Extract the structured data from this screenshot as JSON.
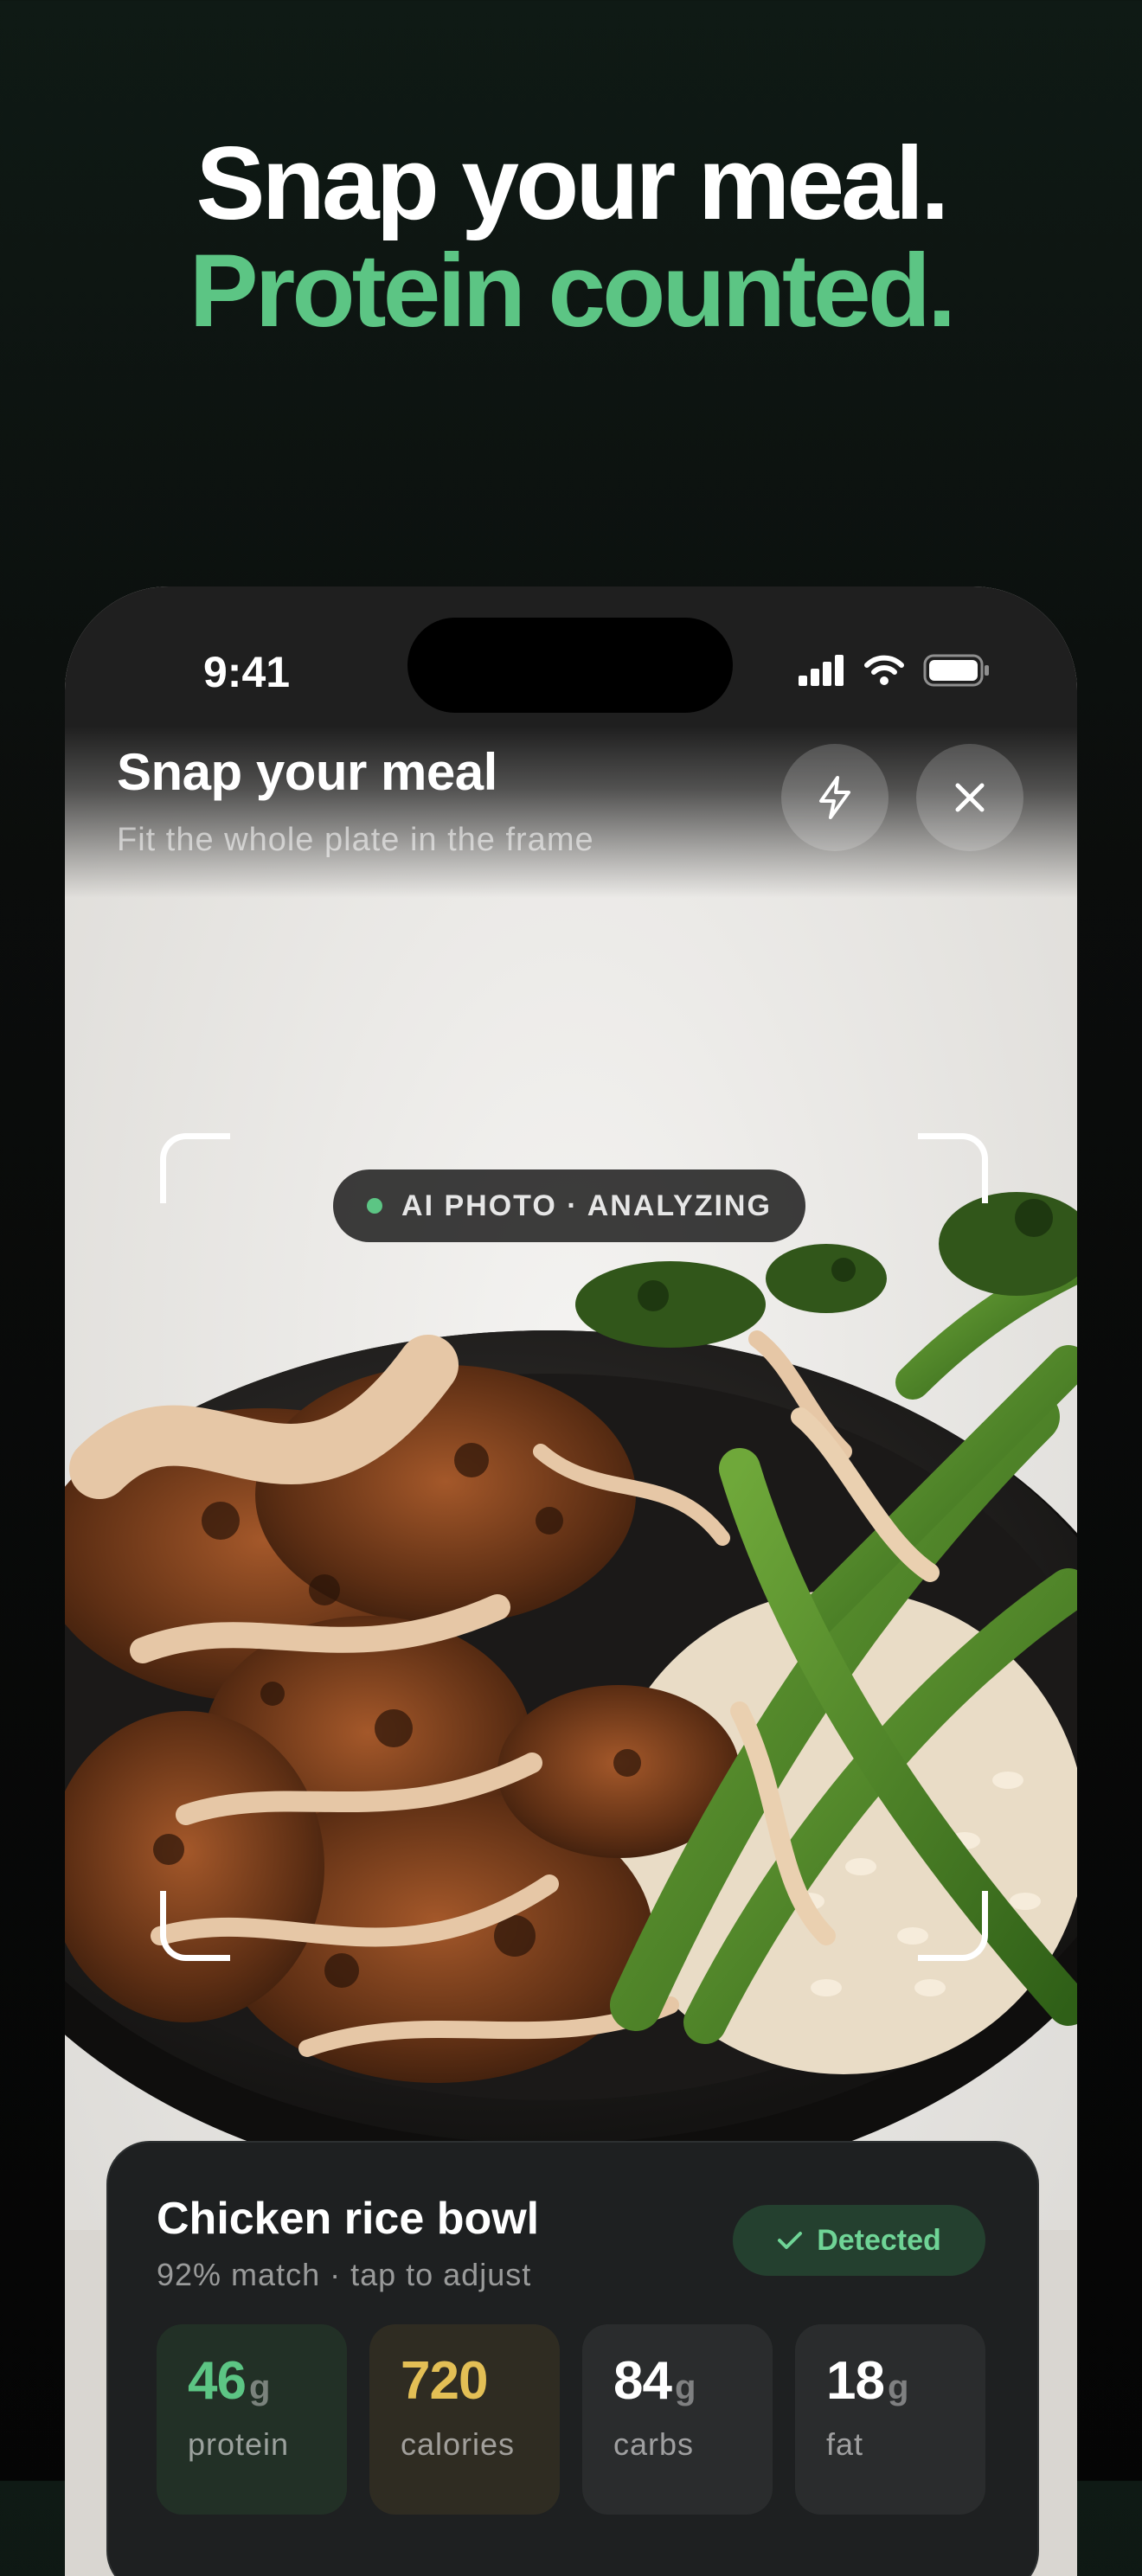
{
  "headline": {
    "line1": "Snap your meal.",
    "line2": "Protein counted."
  },
  "status_bar": {
    "time": "9:41",
    "icons": [
      "cellular-signal-icon",
      "wifi-icon",
      "battery-icon"
    ]
  },
  "camera": {
    "title": "Snap your meal",
    "subtitle": "Fit the whole plate in the frame",
    "flash_icon": "lightning-bolt-icon",
    "close_icon": "close-icon",
    "ai_status": "AI PHOTO · ANALYZING",
    "photo": "chicken rice bowl with broccolini"
  },
  "result": {
    "name": "Chicken rice bowl",
    "subtitle": "92% match · tap to adjust",
    "badge": "Detected",
    "badge_icon": "checkmark-icon",
    "macros": [
      {
        "value": "46",
        "unit": "g",
        "label": "protein",
        "color": "#5cc584"
      },
      {
        "value": "720",
        "unit": "",
        "label": "calories",
        "color": "#e3bf55"
      },
      {
        "value": "84",
        "unit": "g",
        "label": "carbs",
        "color": "#ffffff"
      },
      {
        "value": "18",
        "unit": "g",
        "label": "fat",
        "color": "#ffffff"
      }
    ]
  },
  "colors": {
    "accent_green": "#5cc584",
    "accent_gold": "#e3bf55",
    "card_bg": "#1e2021"
  }
}
